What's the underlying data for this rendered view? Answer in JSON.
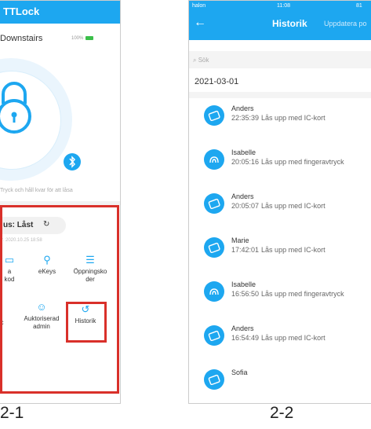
{
  "screen1": {
    "app_title": "TTLock",
    "lock_name": "Downstairs",
    "battery": "100%",
    "hint": "Tryck och håll kvar för att låsa",
    "status": "us: Låst",
    "status_date": "r. 2020.10.25 18:58",
    "grid": [
      {
        "label": "a\nkod",
        "icon": "key-code-icon"
      },
      {
        "label": "eKeys",
        "icon": "ekey-icon"
      },
      {
        "label": "Öppningsko\nder",
        "icon": "list-icon"
      },
      {
        "label": "ryc",
        "icon": "fingerprint-icon"
      },
      {
        "label": "Auktoriserad\nadmin",
        "icon": "admin-icon"
      },
      {
        "label": "Historik",
        "icon": "history-icon"
      }
    ],
    "caption": "2-1"
  },
  "screen2": {
    "status_left": "halon",
    "status_time": "11:08",
    "status_right": "81",
    "title": "Historik",
    "update": "Uppdatera po",
    "search_placeholder": "Sök",
    "date": "2021-03-01",
    "records": [
      {
        "name": "Anders",
        "time": "22:35:39",
        "action": "Lås upp med IC-kort",
        "type": "card"
      },
      {
        "name": "Isabelle",
        "time": "20:05:16",
        "action": "Lås upp med fingeravtryck",
        "type": "finger"
      },
      {
        "name": "Anders",
        "time": "20:05:07",
        "action": "Lås upp med IC-kort",
        "type": "card"
      },
      {
        "name": "Marie",
        "time": "17:42:01",
        "action": "Lås upp med IC-kort",
        "type": "card"
      },
      {
        "name": "Isabelle",
        "time": "16:56:50",
        "action": "Lås upp med fingeravtryck",
        "type": "finger"
      },
      {
        "name": "Anders",
        "time": "16:54:49",
        "action": "Lås upp med IC-kort",
        "type": "card"
      },
      {
        "name": "Sofia",
        "time": "",
        "action": "",
        "type": "card"
      }
    ],
    "caption": "2-2"
  },
  "colors": {
    "primary": "#1da7f0",
    "highlight": "#d9302a"
  }
}
